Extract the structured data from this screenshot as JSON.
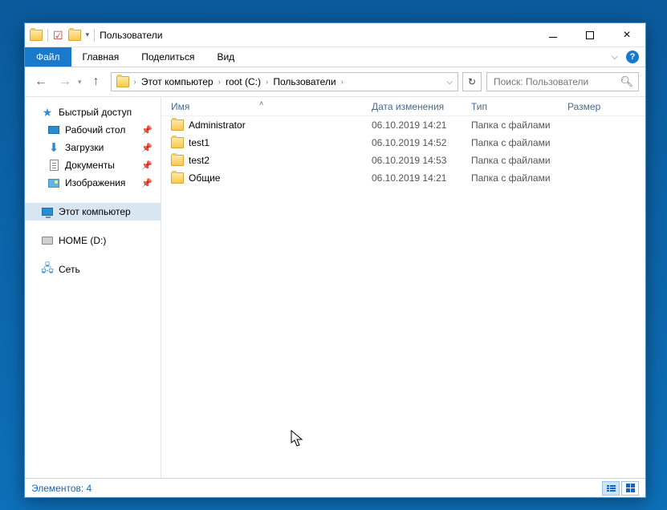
{
  "window": {
    "title": "Пользователи"
  },
  "ribbon": {
    "file": "Файл",
    "tabs": [
      "Главная",
      "Поделиться",
      "Вид"
    ]
  },
  "breadcrumb": {
    "items": [
      "Этот компьютер",
      "root (C:)",
      "Пользователи"
    ]
  },
  "search": {
    "placeholder": "Поиск: Пользователи"
  },
  "sidebar": {
    "quick_access": "Быстрый доступ",
    "desktop": "Рабочий стол",
    "downloads": "Загрузки",
    "documents": "Документы",
    "pictures": "Изображения",
    "this_pc": "Этот компьютер",
    "drive": "HOME (D:)",
    "network": "Сеть"
  },
  "columns": {
    "name": "Имя",
    "date": "Дата изменения",
    "type": "Тип",
    "size": "Размер"
  },
  "rows": [
    {
      "name": "Administrator",
      "date": "06.10.2019 14:21",
      "type": "Папка с файлами"
    },
    {
      "name": "test1",
      "date": "06.10.2019 14:52",
      "type": "Папка с файлами"
    },
    {
      "name": "test2",
      "date": "06.10.2019 14:53",
      "type": "Папка с файлами"
    },
    {
      "name": "Общие",
      "date": "06.10.2019 14:21",
      "type": "Папка с файлами"
    }
  ],
  "status": {
    "label": "Элементов:",
    "count": "4"
  }
}
